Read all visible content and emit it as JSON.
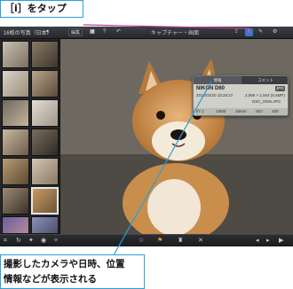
{
  "callouts": {
    "top": "［i］をタップ",
    "bottom_line1": "撮影したカメラや日時、位置",
    "bottom_line2": "情報などが表示される"
  },
  "toolbar": {
    "album_label": "16枚の写真（日本）",
    "edit_label": "編集",
    "title": "キャプチャー・画面"
  },
  "info_panel": {
    "tabs": [
      {
        "label": "情報"
      },
      {
        "label": "コメント"
      }
    ],
    "camera_model": "NIKON D60",
    "datetime": "2012/03/20 15:28:27",
    "resolution": "2,896 × 1,944 (5.6MP)",
    "filename": "DSC_0005.JPG",
    "format_badge": "JPG",
    "exif": [
      "f/7.1",
      "1/500",
      "18mm",
      "ISO",
      "100"
    ]
  },
  "icons": {
    "info": "info-icon",
    "share": "share-icon",
    "undo": "undo-icon",
    "grid": "grid-icon",
    "help": "help-icon",
    "brush": "brush-icon",
    "settings": "gear-icon",
    "flag": "flag-icon",
    "trash": "trash-icon",
    "close": "close-icon",
    "play": "play-icon"
  },
  "colors": {
    "callout_border": "#2aa0d6",
    "magenta_line": "#c23a9b",
    "info_button": "#3b78d0"
  }
}
